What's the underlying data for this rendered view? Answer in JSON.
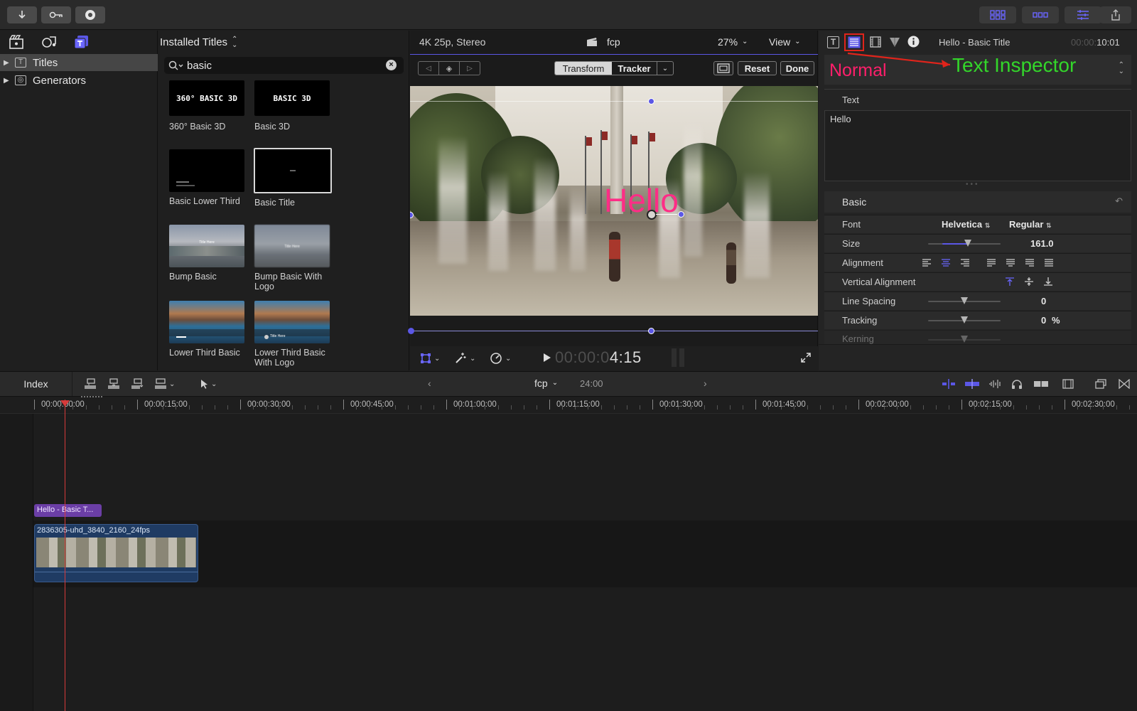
{
  "toolbar": {
    "left_icons": [
      "import-icon",
      "keyword-icon",
      "background-tasks-icon"
    ],
    "right_icons": [
      "browser-layout-icon",
      "timeline-layout-icon",
      "inspector-layout-icon",
      "share-icon"
    ]
  },
  "sidebar": {
    "items": [
      {
        "label": "Titles",
        "selected": true,
        "icon": "titles-icon"
      },
      {
        "label": "Generators",
        "selected": false,
        "icon": "generators-icon"
      }
    ]
  },
  "browser": {
    "header": "Installed Titles",
    "search_value": "basic",
    "thumb_texts": {
      "t360": "360° BASIC 3D",
      "b3d": "BASIC 3D",
      "title_here": "Title Here"
    },
    "items": [
      {
        "label": "360° Basic 3D"
      },
      {
        "label": "Basic 3D"
      },
      {
        "label": "Basic Lower Third"
      },
      {
        "label": "Basic Title"
      },
      {
        "label": "Bump Basic"
      },
      {
        "label": "Bump Basic With Logo"
      },
      {
        "label": "Lower Third Basic"
      },
      {
        "label": "Lower Third Basic With Logo"
      }
    ]
  },
  "viewer": {
    "format": "4K 25p, Stereo",
    "project": "fcp",
    "zoom": "27%",
    "view_label": "View",
    "transform_tab": "Transform",
    "tracker_tab": "Tracker",
    "reset_label": "Reset",
    "done_label": "Done",
    "overlay_text": "Hello",
    "timecode_dim": "00:00:0",
    "timecode_bright": "4:15"
  },
  "inspector": {
    "title": "Hello - Basic Title",
    "timecode_dim": "00:00:",
    "timecode_bright": "10:01",
    "preset": "Normal",
    "annotation": "Text Inspector",
    "text_section": "Text",
    "text_value": "Hello",
    "basic_section": "Basic",
    "font_label": "Font",
    "font_value": "Helvetica",
    "font_style": "Regular",
    "size_label": "Size",
    "size_value": "161.0",
    "alignment_label": "Alignment",
    "vertical_alignment_label": "Vertical Alignment",
    "line_spacing_label": "Line Spacing",
    "line_spacing_value": "0",
    "tracking_label": "Tracking",
    "tracking_value": "0",
    "tracking_unit": "%",
    "kerning_label": "Kerning",
    "accent_color": "#5b57e6",
    "annotation_color": "#33d62a",
    "preset_color": "#ff1f6b",
    "highlight_color": "#e0241b"
  },
  "timeline": {
    "index_label": "Index",
    "project": "fcp",
    "duration": "24:00",
    "ruler_labels": [
      "00:00:00:00",
      "00:00:15:00",
      "00:00:30:00",
      "00:00:45:00",
      "00:01:00:00",
      "00:01:15:00",
      "00:01:30:00",
      "00:01:45:00",
      "00:02:00:00",
      "00:02:15:00",
      "00:02:30:00"
    ],
    "title_clip": "Hello - Basic T...",
    "video_clip": "2836305-uhd_3840_2160_24fps"
  }
}
